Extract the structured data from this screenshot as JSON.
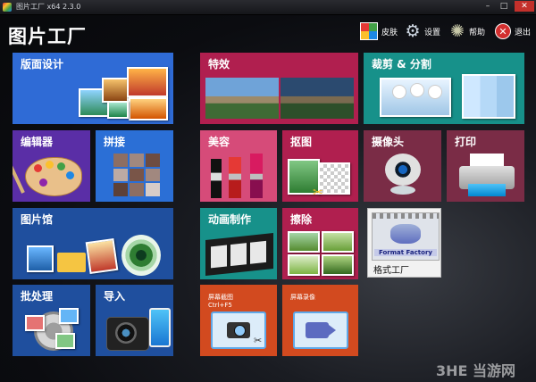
{
  "window": {
    "title": "图片工厂 x64 2.3.0",
    "minimize_glyph": "–",
    "maximize_glyph": "□",
    "close_glyph": "✕"
  },
  "app": {
    "name": "图片工厂"
  },
  "toolbar": {
    "skin_label": "皮肤",
    "settings_label": "设置",
    "help_label": "帮助",
    "exit_label": "退出",
    "exit_glyph": "✕",
    "settings_glyph": "⚙",
    "help_glyph": "✺"
  },
  "tiles": {
    "layout_design": {
      "label": "版面设计",
      "color": "#2f6bd6"
    },
    "editor": {
      "label": "编辑器",
      "color": "#5a2ea6"
    },
    "stitch": {
      "label": "拼接",
      "color": "#2b6fd6"
    },
    "gallery": {
      "label": "图片馆",
      "color": "#1f4f9e"
    },
    "batch": {
      "label": "批处理",
      "color": "#1f4f9e"
    },
    "import": {
      "label": "导入",
      "color": "#1f4f9e"
    },
    "effects": {
      "label": "特效",
      "color": "#b01f4f"
    },
    "beauty": {
      "label": "美容",
      "color": "#d64b79"
    },
    "cutout": {
      "label": "抠图",
      "color": "#b01f4f"
    },
    "animation": {
      "label": "动画制作",
      "color": "#17918a"
    },
    "erase": {
      "label": "擦除",
      "color": "#b01f4f"
    },
    "screenshot": {
      "label": "屏幕截图\nCtrl+F5",
      "color": "#d24a1f"
    },
    "screen_record": {
      "label": "屏幕录像",
      "color": "#d24a1f"
    },
    "crop_split": {
      "label": "裁剪 & 分割",
      "color": "#17918a"
    },
    "camera": {
      "label": "摄像头",
      "color": "#7a2c46"
    },
    "print": {
      "label": "打印",
      "color": "#7a2c46"
    },
    "format_factory": {
      "label": "格式工厂",
      "logo_text": "Format Factory"
    }
  },
  "watermark": {
    "text": "3HE 当游网"
  }
}
